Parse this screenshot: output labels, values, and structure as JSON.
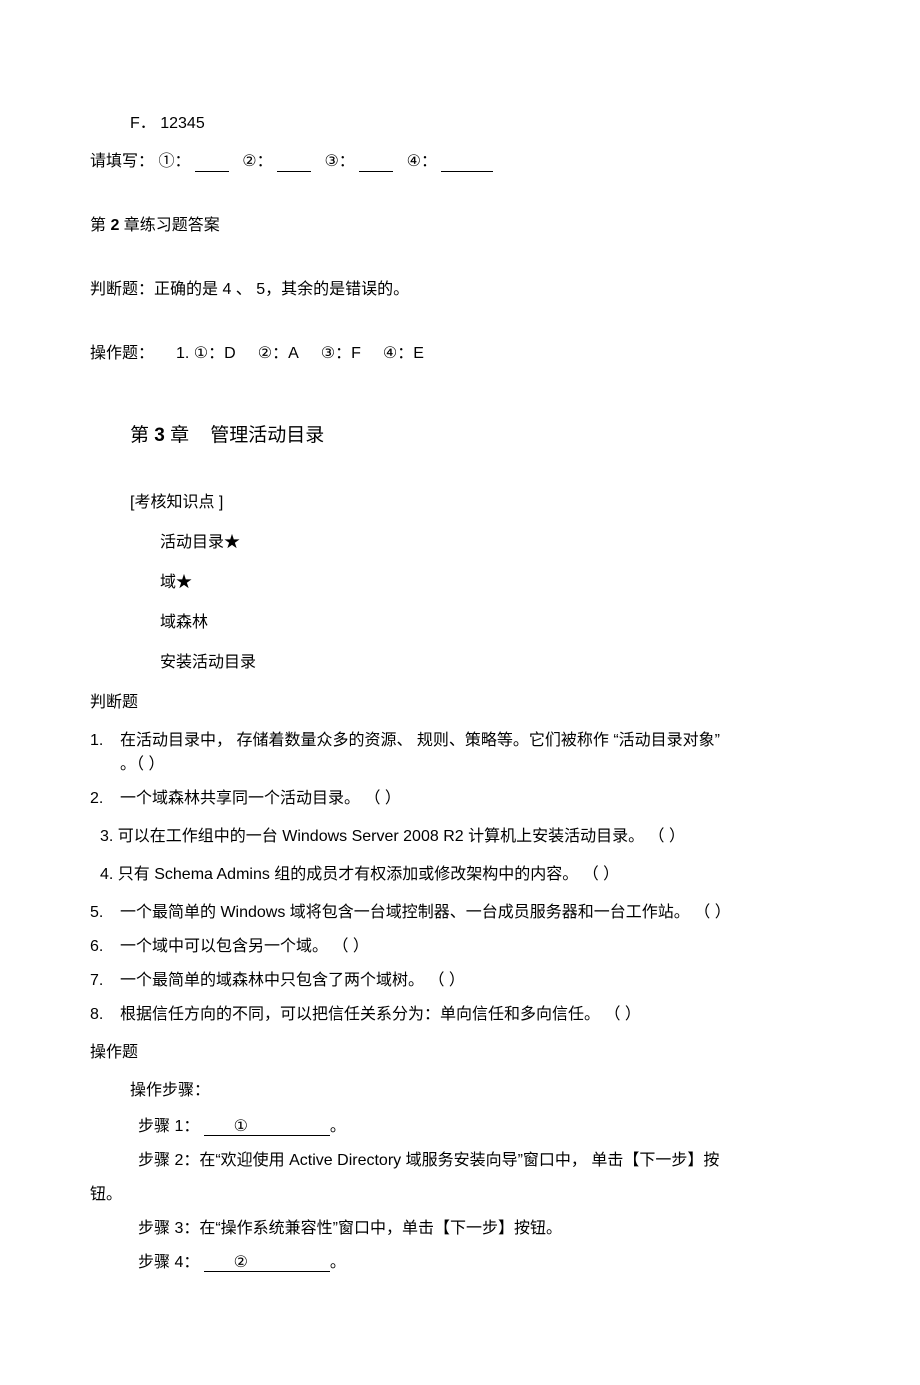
{
  "line_f": "F．  12345",
  "fill": {
    "prefix": "请填写：",
    "c1": "①：",
    "c2": "②：",
    "c3": "③：",
    "c4": "④："
  },
  "ans_header": "第 2 章练习题答案",
  "judge_ans": "判断题：正确的是    4 、 5，其余的是错误的。",
  "op_ans": {
    "prefix": "操作题：",
    "a1": "1. ①：D",
    "a2": "②：A",
    "a3": "③：F",
    "a4": "④：E"
  },
  "chapter3": {
    "pre": "第 ",
    "num": "3",
    "mid": " 章",
    "title": "管理活动目录"
  },
  "points_label": "[考核知识点 ]",
  "points": [
    "活动目录★",
    "域★",
    "域森林",
    "安装活动目录"
  ],
  "judge_label": "判断题",
  "q1_num": "1.",
  "q1_a": "在活动目录中，  存储着数量众多的资源、  规则、策略等。它们被称作  “活动目录对象”",
  "q1_b": "。（  ）",
  "q2_num": "2.",
  "q2": "一个域森林共享同一个活动目录。 （      ）",
  "q3": "3.  可以在工作组中的一台  Windows Server 2008 R2  计算机上安装活动目录。   （      ）",
  "q4": "4. 只有 Schema Admins 组的成员才有权添加或修改架构中的内容。    （      ）",
  "q5_num": "5.",
  "q5": "一个最简单的  Windows 域将包含一台域控制器、一台成员服务器和一台工作站。       （    ）",
  "q6_num": "6.",
  "q6": "一个域中可以包含另一个域。  （      ）",
  "q7_num": "7.",
  "q7": "一个最简单的域森林中只包含了两个域树。   （      ）",
  "q8_num": "8.",
  "q8": "根据信任方向的不同，可以把信任关系分为：单向信任和多向信任。     （      ）",
  "op_label": "操作题",
  "op_steps_label": "操作步骤：",
  "step1_label": "步骤 1：",
  "step1_fill": "①",
  "step_end": "。",
  "step2": "步骤 2：在“欢迎使用 Active Directory 域服务安装向导”窗口中，   单击【下一步】按",
  "step2_tail": "钮。",
  "step3": "步骤 3：在“操作系统兼容性”窗口中，单击【下一步】按钮。",
  "step4_label": "步骤 4：",
  "step4_fill": "②"
}
